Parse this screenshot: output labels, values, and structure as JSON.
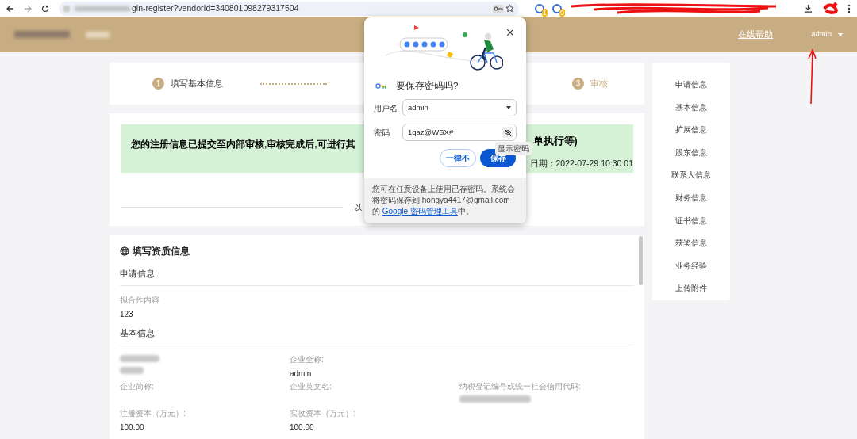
{
  "browser": {
    "url": "gin-register?vendorId=340801098279317504",
    "extension_badges": [
      "1",
      "0"
    ]
  },
  "header": {
    "help_link": "在线帮助",
    "user": "admin"
  },
  "steps": [
    {
      "number": "1",
      "label": "填写基本信息",
      "selected": false
    },
    {
      "number": "3",
      "label": "审核",
      "selected": true
    }
  ],
  "notice": {
    "message_start": "您的注册信息已提交至内部审核,审核完成后,可进行其",
    "message_end": "单执行等)",
    "date": "日期：2022-07-29 10:30:01"
  },
  "divider_text": "以",
  "qualification": {
    "title": "填写资质信息",
    "sections": [
      {
        "title": "申请信息",
        "rows": [
          [
            {
              "kind": "text",
              "label": "拟合作内容",
              "value": "123"
            }
          ]
        ]
      },
      {
        "title": "基本信息",
        "rows": [
          [
            {
              "kind": "redacted"
            },
            {
              "kind": "text",
              "label": "企业全称:",
              "value": "admin"
            }
          ],
          [
            {
              "kind": "text",
              "label": "企业简称:"
            },
            {
              "kind": "text",
              "label": "企业英文名:"
            },
            {
              "kind": "value-redacted",
              "label": "纳税登记编号或统一社会信用代码:"
            }
          ],
          [
            {
              "kind": "text",
              "label": "注册资本（万元）:",
              "value": "100.00"
            },
            {
              "kind": "text",
              "label": "实收资本（万元）:",
              "value": "100.00"
            }
          ]
        ]
      }
    ]
  },
  "sidebar": {
    "items": [
      "申请信息",
      "基本信息",
      "扩展信息",
      "股东信息",
      "联系人信息",
      "财务信息",
      "证书信息",
      "获奖信息",
      "业务经验",
      "上传附件"
    ]
  },
  "dialog": {
    "title": "要保存密码吗?",
    "username_label": "用户名",
    "username_value": "admin",
    "password_label": "密码",
    "password_value": "1qaz@WSX#",
    "tooltip": "显示密码",
    "buttons": [
      {
        "label": "一律不",
        "kind": "secondary"
      },
      {
        "label": "保存",
        "kind": "primary"
      }
    ],
    "footer_text": "您可在任意设备上使用已存密码。系统会将密码保存到 hongya4417@gmail.com 的 ",
    "footer_link": "Google 密码管理工具",
    "footer_end": "中。"
  }
}
